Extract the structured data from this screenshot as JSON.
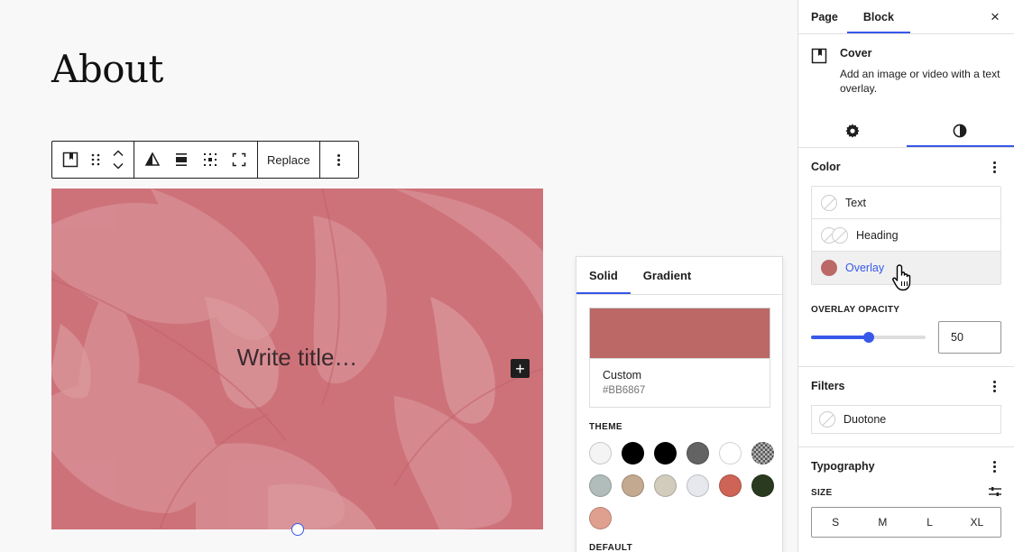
{
  "editor": {
    "page_title": "About",
    "toolbar": {
      "replace_label": "Replace"
    },
    "cover": {
      "title_placeholder": "Write title…",
      "add_block_symbol": "+"
    }
  },
  "color_popover": {
    "tabs": [
      {
        "label": "Solid",
        "active": true
      },
      {
        "label": "Gradient",
        "active": false
      }
    ],
    "custom": {
      "label": "Custom",
      "hex": "#BB6867",
      "color": "#BB6867"
    },
    "theme_heading": "THEME",
    "theme_colors": [
      "#f4f4f4",
      "#000000",
      "#000000",
      "#636363",
      "#ffffff",
      "#8a8a8a",
      "#b0bdba",
      "#c2a990",
      "#d2ccbd",
      "#e6e8ed",
      "#cd6455",
      "#2a3a1e",
      "#e0a08f"
    ],
    "default_heading": "DEFAULT"
  },
  "sidebar": {
    "tabs": [
      {
        "label": "Page",
        "active": false
      },
      {
        "label": "Block",
        "active": true
      }
    ],
    "close_symbol": "×",
    "block": {
      "title": "Cover",
      "description": "Add an image or video with a text overlay."
    },
    "color_panel": {
      "title": "Color",
      "items": [
        {
          "label": "Text"
        },
        {
          "label": "Heading"
        },
        {
          "label": "Overlay",
          "color": "#BB6867"
        }
      ]
    },
    "overlay_opacity": {
      "label": "OVERLAY OPACITY",
      "value": "50",
      "fraction": 0.5
    },
    "filters_panel": {
      "title": "Filters",
      "duotone_label": "Duotone"
    },
    "typography_panel": {
      "title": "Typography",
      "size_label": "SIZE",
      "sizes": [
        "S",
        "M",
        "L",
        "XL"
      ]
    }
  },
  "colors": {
    "accent": "#3858e9",
    "overlay": "#BB6867"
  }
}
